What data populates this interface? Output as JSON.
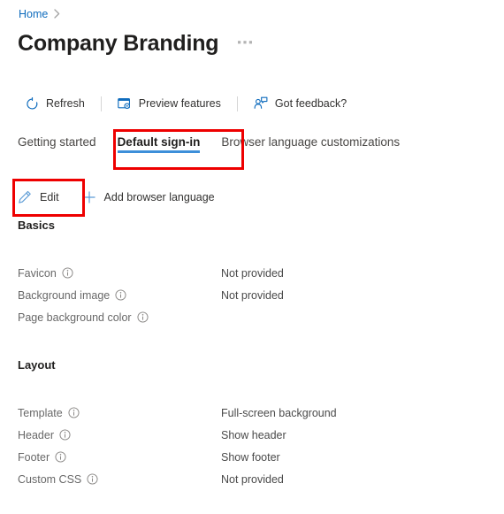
{
  "breadcrumb": {
    "home_label": "Home",
    "separator": "›"
  },
  "header": {
    "title": "Company Branding",
    "ellipsis": "⋯",
    "more_icon": "ellipsis-icon"
  },
  "command_bar": {
    "items": [
      {
        "label": "Refresh",
        "icon": "refresh-icon"
      },
      {
        "label": "Preview features",
        "icon": "preview-features-icon"
      },
      {
        "label": "Got feedback?",
        "icon": "feedback-icon"
      }
    ]
  },
  "tabs": [
    {
      "label": "Getting started",
      "selected": false
    },
    {
      "label": "Default sign-in",
      "selected": true
    },
    {
      "label": "Browser language customizations",
      "selected": false
    }
  ],
  "action_bar": {
    "edit": {
      "label": "Edit",
      "icon": "pencil-icon"
    },
    "add_language": {
      "label": "Add browser language",
      "icon": "plus-icon"
    }
  },
  "sections": [
    {
      "heading": "Basics",
      "rows": [
        {
          "label": "Favicon",
          "info_icon": "info-icon",
          "value": "Not provided"
        },
        {
          "label": "Background image",
          "info_icon": "info-icon",
          "value": "Not provided"
        },
        {
          "label": "Page background color",
          "info_icon": "info-icon",
          "value": ""
        }
      ]
    },
    {
      "heading": "Layout",
      "rows": [
        {
          "label": "Template",
          "info_icon": "info-icon",
          "value": "Full-screen background"
        },
        {
          "label": "Header",
          "info_icon": "info-icon",
          "value": "Show header"
        },
        {
          "label": "Footer",
          "info_icon": "info-icon",
          "value": "Show footer"
        },
        {
          "label": "Custom CSS",
          "info_icon": "info-icon",
          "value": "Not provided"
        }
      ]
    }
  ],
  "annotations": [
    {
      "name": "highlight-default-signin-tab",
      "color": "#ee0000"
    },
    {
      "name": "highlight-edit-button",
      "color": "#ee0000"
    }
  ],
  "colors": {
    "link_blue": "#0f6cbd",
    "accent_blue": "#3d8fd9",
    "icon_blue": "#0f6cbd",
    "annotation_red": "#ee0000",
    "label_gray": "#686868",
    "value_gray": "#4a4a4a"
  }
}
